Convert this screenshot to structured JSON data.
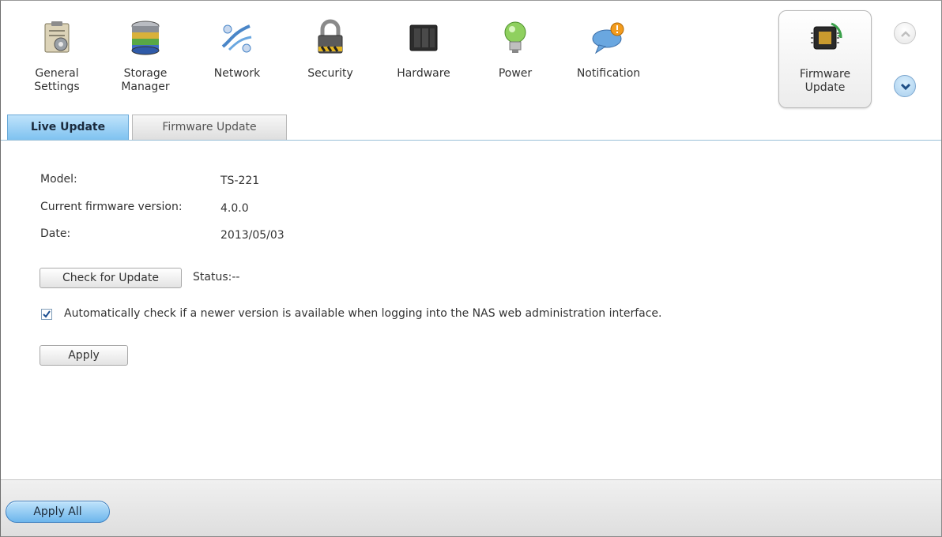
{
  "toolbar": {
    "items": [
      {
        "label": "General\nSettings",
        "icon": "clipboard-settings-icon"
      },
      {
        "label": "Storage\nManager",
        "icon": "storage-disks-icon"
      },
      {
        "label": "Network",
        "icon": "network-icon"
      },
      {
        "label": "Security",
        "icon": "padlock-icon"
      },
      {
        "label": "Hardware",
        "icon": "hardware-nas-icon"
      },
      {
        "label": "Power",
        "icon": "lightbulb-icon"
      },
      {
        "label": "Notification",
        "icon": "speech-bubble-alert-icon"
      },
      {
        "label": "Firmware\nUpdate",
        "icon": "chip-update-icon",
        "active": true
      }
    ]
  },
  "tabs": {
    "live_update": "Live Update",
    "firmware_update": "Firmware Update"
  },
  "info": {
    "model_label": "Model:",
    "model_value": "TS-221",
    "version_label": "Current firmware version:",
    "version_value": "4.0.0",
    "date_label": "Date:",
    "date_value": "2013/05/03"
  },
  "actions": {
    "check_label": "Check for Update",
    "status_text": "Status:--",
    "auto_check_label": "Automatically check if a newer version is available when logging into the NAS web administration interface.",
    "auto_check_checked": true,
    "apply_label": "Apply"
  },
  "footer": {
    "apply_all_label": "Apply All"
  },
  "colors": {
    "accent": "#7fc2f0",
    "accent_border": "#3c7fc0"
  }
}
